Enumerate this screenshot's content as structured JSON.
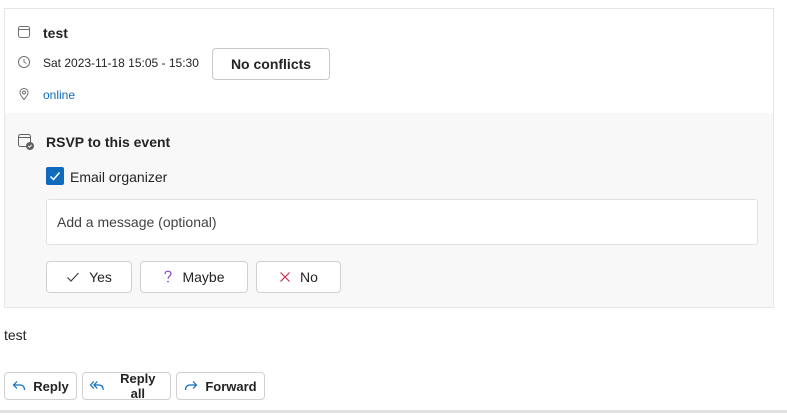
{
  "event": {
    "title": "test",
    "datetime": "Sat 2023-11-18 15:05 - 15:30",
    "conflicts_label": "No conflicts",
    "location": "online"
  },
  "rsvp": {
    "heading": "RSVP to this event",
    "email_organizer_label": "Email organizer",
    "email_organizer_checked": true,
    "message_placeholder": "Add a message (optional)",
    "message_value": "",
    "yes_label": "Yes",
    "maybe_label": "Maybe",
    "no_label": "No"
  },
  "body": {
    "text": "test"
  },
  "actions": {
    "reply_label": "Reply",
    "reply_all_label": "Reply all",
    "forward_label": "Forward"
  },
  "colors": {
    "accent": "#0f6cbd",
    "panel_bg": "#f8f8f8",
    "no_icon": "#c4314b",
    "maybe_icon": "#8a3ab9"
  },
  "icons": {
    "title": "calendar-icon",
    "datetime": "clock-icon",
    "location": "location-pin-icon",
    "rsvp": "calendar-rsvp-icon",
    "yes": "checkmark-icon",
    "maybe": "question-mark-icon",
    "no": "dismiss-icon",
    "reply": "reply-arrow-icon",
    "reply_all": "reply-all-arrow-icon",
    "forward": "forward-arrow-icon"
  }
}
